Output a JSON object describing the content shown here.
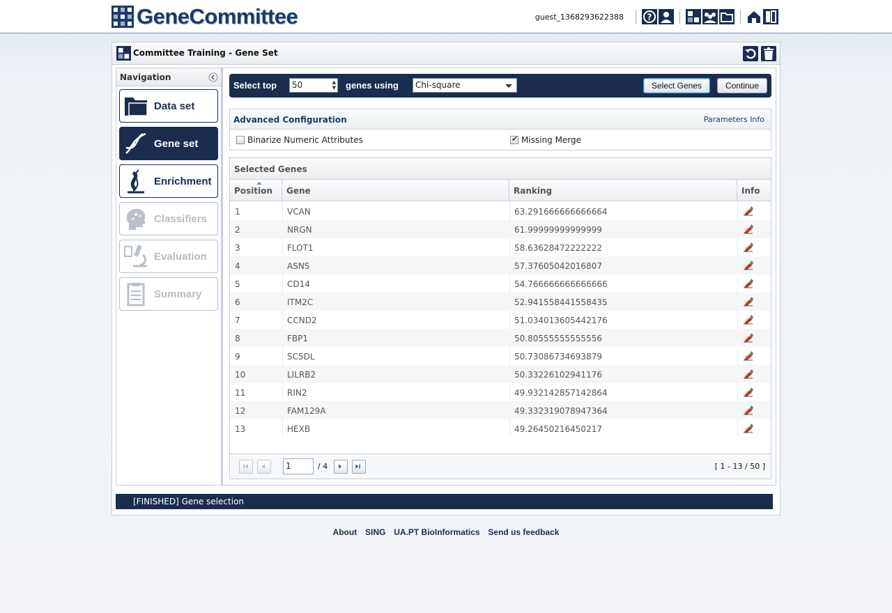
{
  "app": {
    "logo_text": "GeneCommittee"
  },
  "user": {
    "name": "guest_1368293622388"
  },
  "panel": {
    "title": "Committee Training - Gene Set"
  },
  "navigation": {
    "title": "Navigation",
    "items": [
      {
        "label": "Data set",
        "icon": "folder-icon",
        "state": "normal"
      },
      {
        "label": "Gene set",
        "icon": "dna-icon",
        "state": "active"
      },
      {
        "label": "Enrichment",
        "icon": "dna-wrap-icon",
        "state": "normal"
      },
      {
        "label": "Classifiers",
        "icon": "brain-icon",
        "state": "disabled"
      },
      {
        "label": "Evaluation",
        "icon": "microscope-icon",
        "state": "disabled"
      },
      {
        "label": "Summary",
        "icon": "clipboard-icon",
        "state": "disabled"
      }
    ]
  },
  "toolbar": {
    "select_top_label": "Select top",
    "top_value": "50",
    "genes_using_label": "genes using",
    "method_value": "Chi-square",
    "select_genes_label": "Select Genes",
    "continue_label": "Continue"
  },
  "advanced": {
    "title": "Advanced Configuration",
    "info_link": "Parameters Info",
    "binarize_label": "Binarize Numeric Attributes",
    "binarize_checked": false,
    "missing_merge_label": "Missing Merge",
    "missing_merge_checked": true
  },
  "selected_genes": {
    "title": "Selected Genes",
    "columns": [
      "Position",
      "Gene",
      "Ranking",
      "Info"
    ],
    "rows": [
      {
        "position": "1",
        "gene": "VCAN",
        "ranking": "63.291666666666664"
      },
      {
        "position": "2",
        "gene": "NRGN",
        "ranking": "61.99999999999999"
      },
      {
        "position": "3",
        "gene": "FLOT1",
        "ranking": "58.63628472222222"
      },
      {
        "position": "4",
        "gene": "ASNS",
        "ranking": "57.37605042016807"
      },
      {
        "position": "5",
        "gene": "CD14",
        "ranking": "54.766666666666666"
      },
      {
        "position": "6",
        "gene": "ITM2C",
        "ranking": "52.941558441558435"
      },
      {
        "position": "7",
        "gene": "CCND2",
        "ranking": "51.034013605442176"
      },
      {
        "position": "8",
        "gene": "FBP1",
        "ranking": "50.80555555555556"
      },
      {
        "position": "9",
        "gene": "SC5DL",
        "ranking": "50.73086734693879"
      },
      {
        "position": "10",
        "gene": "LILRB2",
        "ranking": "50.33226102941176"
      },
      {
        "position": "11",
        "gene": "RIN2",
        "ranking": "49.932142857142864"
      },
      {
        "position": "12",
        "gene": "FAM129A",
        "ranking": "49.332319078947364"
      },
      {
        "position": "13",
        "gene": "HEXB",
        "ranking": "49.26450216450217"
      }
    ],
    "pager": {
      "page": "1",
      "total": "/ 4",
      "range": "[ 1 - 13 / 50 ]"
    }
  },
  "status": {
    "text": "[FINISHED] Gene selection"
  },
  "footer": {
    "links": [
      "About",
      "SING",
      "UA.PT BioInformatics",
      "Send us feedback"
    ]
  },
  "colors": {
    "navy": "#1a2d4f",
    "link": "#1a3a76"
  }
}
